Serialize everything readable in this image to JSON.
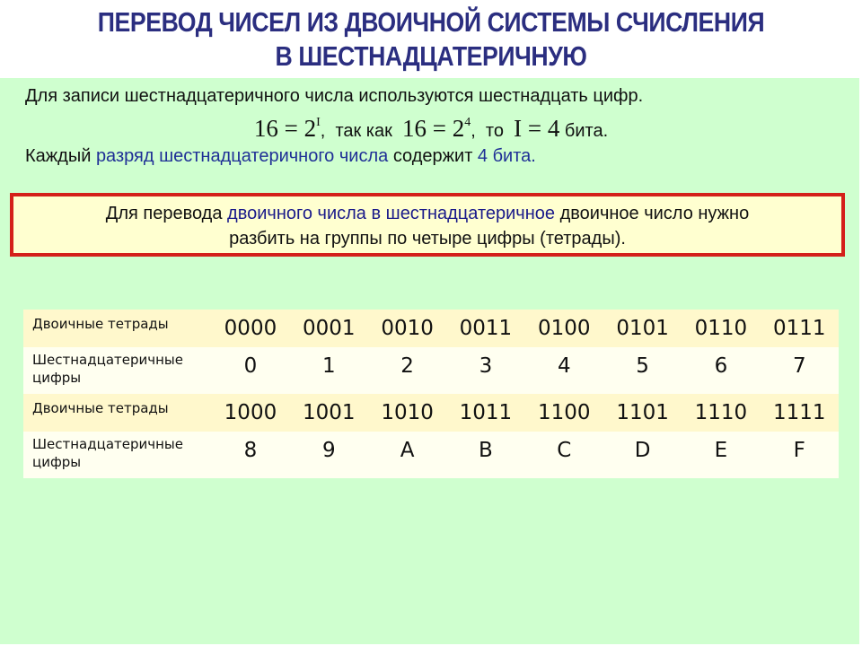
{
  "title": {
    "line1": "ПЕРЕВОД ЧИСЕЛ ИЗ ДВОИЧНОЙ СИСТЕМЫ СЧИСЛЕНИЯ",
    "line2": "В ШЕСТНАДЦАТЕРИЧНУЮ"
  },
  "intro": {
    "line1": "Для записи шестнадцатеричного числа используются шестнадцать цифр.",
    "formula": {
      "part1_base": "16 = 2",
      "part1_exp": "I",
      "part1_sep": ",",
      "text_since": "так как",
      "part2_base": "16 = 2",
      "part2_exp": "4",
      "part2_sep": ",",
      "text_then": "то",
      "part3": "I = 4",
      "text_bits": "бита."
    },
    "line3": {
      "prefix": "Каждый",
      "highlight": "разряд шестнадцатеричного числа",
      "middle": "содержит",
      "highlight2": "4 бита."
    }
  },
  "callout": {
    "prefix": "Для перевода",
    "highlight": "двоичного числа в шестнадцатеричное",
    "suffix": "двоичное число нужно",
    "line2": "разбить на группы по четыре цифры (тетрады)."
  },
  "table": {
    "rows": [
      {
        "type": "bin",
        "label": "Двоичные тетрады",
        "values": [
          "0000",
          "0001",
          "0010",
          "0011",
          "0100",
          "0101",
          "0110",
          "0111"
        ]
      },
      {
        "type": "hex",
        "label": "Шестнадцатеричные цифры",
        "values": [
          "0",
          "1",
          "2",
          "3",
          "4",
          "5",
          "6",
          "7"
        ]
      },
      {
        "type": "bin",
        "label": "Двоичные тетрады",
        "values": [
          "1000",
          "1001",
          "1010",
          "1011",
          "1100",
          "1101",
          "1110",
          "1111"
        ]
      },
      {
        "type": "hex",
        "label": "Шестнадцатеричные цифры",
        "values": [
          "8",
          "9",
          "A",
          "B",
          "C",
          "D",
          "E",
          "F"
        ]
      }
    ]
  },
  "colors": {
    "title": "#2b2e80",
    "panel_bg": "#cfffcf",
    "highlight_text": "#1f2f96",
    "callout_border": "#d4201a",
    "callout_bg": "#ffffd0",
    "table_bin_row": "#fff8cc",
    "table_hex_row": "#fffff0"
  }
}
